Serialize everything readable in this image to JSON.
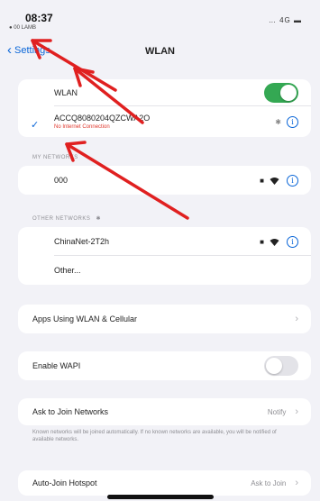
{
  "status": {
    "time": "08:37",
    "sub": "● 00 LAMB",
    "right": "… 4G ▬"
  },
  "nav": {
    "back_label": "Settings",
    "title": "WLAN"
  },
  "wlan_card": {
    "wlan_label": "WLAN",
    "wlan_toggle_on": true,
    "connected_ssid": "ACCQ8080204QZCWA2O",
    "connected_status": "No Internet Connection"
  },
  "my_networks": {
    "header": "MY NETWORKS",
    "items": [
      {
        "name": "000"
      }
    ]
  },
  "other_networks": {
    "header": "OTHER NETWORKS",
    "items": [
      {
        "name": "ChinaNet-2T2h"
      }
    ],
    "other_label": "Other..."
  },
  "apps_row": {
    "label": "Apps Using WLAN & Cellular"
  },
  "wapi_row": {
    "label": "Enable WAPI",
    "toggle_on": false
  },
  "ask_row": {
    "label": "Ask to Join Networks",
    "value": "Notify",
    "footnote": "Known networks will be joined automatically. If no known networks are available, you will be notified of available networks."
  },
  "hotspot_row": {
    "label": "Auto-Join Hotspot",
    "value": "Ask to Join"
  },
  "colors": {
    "accent": "#0a66d8",
    "toggle_on": "#34a853",
    "annotation": "#e02020"
  },
  "icons": [
    "back-chevron-icon",
    "checkmark-icon",
    "info-icon",
    "lock-icon",
    "wifi-icon",
    "spinner-icon",
    "chevron-right-icon"
  ]
}
